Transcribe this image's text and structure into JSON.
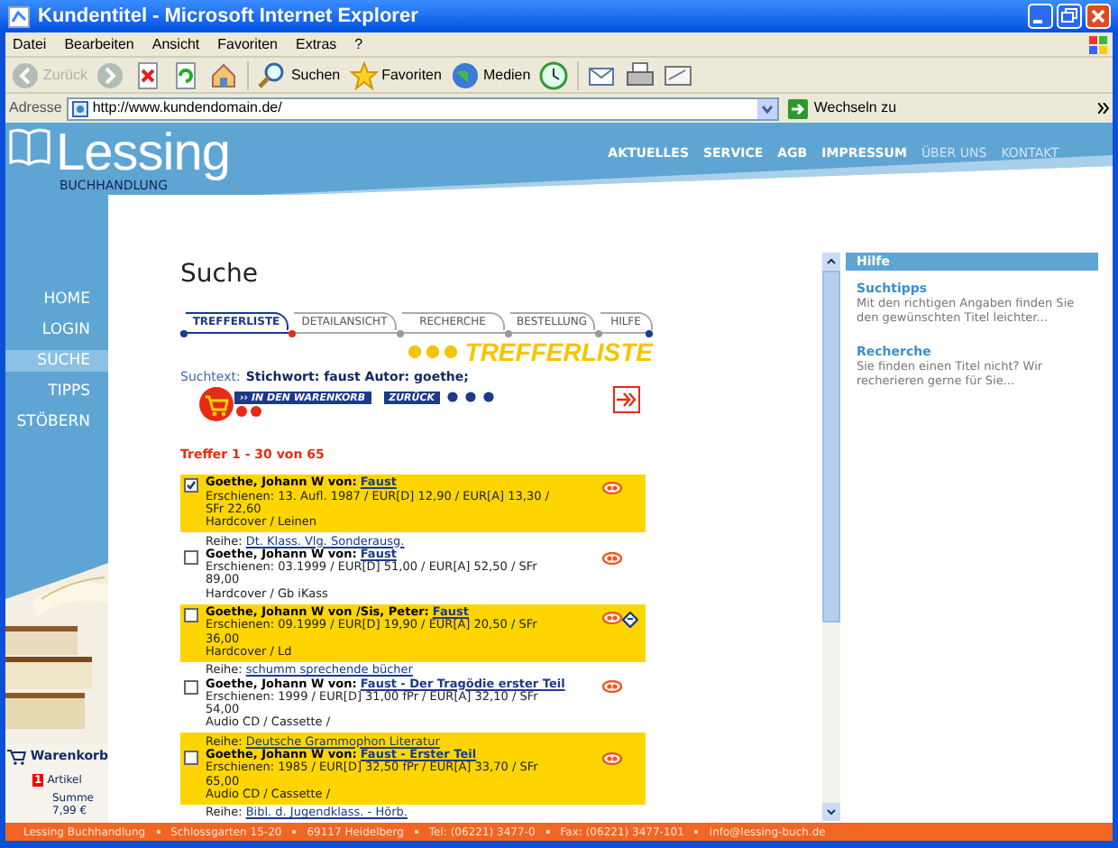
{
  "window": {
    "title": "Kundentitel - Microsoft Internet Explorer"
  },
  "menu": [
    "Datei",
    "Bearbeiten",
    "Ansicht",
    "Favoriten",
    "Extras",
    "?"
  ],
  "toolbar": [
    {
      "kind": "back",
      "label": "Zurück",
      "disabled": true
    },
    {
      "kind": "forward",
      "disabled": true
    },
    {
      "kind": "stop",
      "disabled": false
    },
    {
      "kind": "refresh",
      "disabled": false
    },
    {
      "kind": "home",
      "disabled": false
    },
    {
      "kind": "search",
      "label": "Suchen",
      "disabled": false
    },
    {
      "kind": "favorites",
      "label": "Favoriten",
      "disabled": false
    },
    {
      "kind": "media",
      "label": "Medien",
      "disabled": false
    },
    {
      "kind": "history",
      "disabled": false
    },
    {
      "kind": "mail",
      "disabled": false
    },
    {
      "kind": "print",
      "disabled": false
    },
    {
      "kind": "edit",
      "disabled": false
    }
  ],
  "address": {
    "label": "Adresse",
    "value": "http://www.kundendomain.de/",
    "go": "Wechseln zu"
  },
  "site": {
    "logo": "Lessing",
    "logo_sub": "BUCHHANDLUNG",
    "top_nav": [
      {
        "label": "AKTUELLES",
        "dimmed": false
      },
      {
        "label": "SERVICE",
        "dimmed": false
      },
      {
        "label": "AGB",
        "dimmed": false
      },
      {
        "label": "IMPRESSUM",
        "dimmed": false
      },
      {
        "label": "ÜBER UNS",
        "dimmed": true
      },
      {
        "label": "KONTAKT",
        "dimmed": true
      }
    ],
    "side_nav": [
      {
        "label": "HOME",
        "selected": false
      },
      {
        "label": "LOGIN",
        "selected": false
      },
      {
        "label": "SUCHE",
        "selected": true
      },
      {
        "label": "TIPPS",
        "selected": false
      },
      {
        "label": "STÖBERN",
        "selected": false
      }
    ],
    "cart": {
      "title": "Warenkorb",
      "count": "1",
      "count_label": "Artikel",
      "sum_label": "Summe",
      "sum": "7,99 €"
    }
  },
  "page": {
    "heading": "Suche",
    "steps": [
      {
        "label": "TREFFERLISTE",
        "selected": true
      },
      {
        "label": "DETAILANSICHT",
        "selected": false
      },
      {
        "label": "RECHERCHE",
        "selected": false
      },
      {
        "label": "BESTELLUNG",
        "selected": false
      },
      {
        "label": "HILFE",
        "selected": false
      }
    ],
    "step_title": "TREFFERLISTE",
    "search_label": "Suchtext:",
    "search_text": "Stichwort: faust Autor: goethe;",
    "buttons": [
      "›› IN DEN WARENKORB",
      "ZURÜCK"
    ],
    "hits": "Treffer 1 - 30 von 65",
    "results": [
      {
        "checked": true,
        "author": "Goethe, Johann W von:",
        "title": "Faust",
        "details": "Erschienen: 13. Aufl. 1987 / EUR[D] 12,90 / EUR[A] 13,30 / SFr 22,60",
        "format": "Hardcover / Leinen",
        "icons": [
          {
            "kind": "preview"
          }
        ]
      },
      {
        "reihe_label": "Reihe:",
        "reihe": "Dt. Klass. Vlg. Sonderausg.",
        "checked": false,
        "author": "Goethe, Johann W von:",
        "title": "Faust",
        "details": "Erschienen: 03.1999 / EUR[D] 51,00 / EUR[A] 52,50 / SFr 89,00",
        "format": "Hardcover / Gb iKass",
        "icons": [
          {
            "kind": "preview"
          }
        ]
      },
      {
        "checked": false,
        "author": "Goethe, Johann W von /Sis, Peter:",
        "title": "Faust",
        "details": "Erschienen: 09.1999 / EUR[D] 19,90 / EUR[A] 20,50 / SFr 36,00",
        "format": "Hardcover / Ld",
        "icons": [
          {
            "kind": "preview"
          },
          {
            "kind": "note"
          }
        ]
      },
      {
        "reihe_label": "Reihe:",
        "reihe": "schumm sprechende bücher",
        "checked": false,
        "author": "Goethe, Johann W von:",
        "title": "Faust - Der Tragödie erster Teil",
        "details": "Erschienen: 1999 / EUR[D] 31,00 fPr / EUR[A] 32,10 / SFr 54,00",
        "format": "Audio CD / Cassette /",
        "icons": [
          {
            "kind": "preview"
          }
        ]
      },
      {
        "reihe_label": "Reihe:",
        "reihe": "Deutsche Grammophon Literatur",
        "checked": false,
        "author": "Goethe, Johann W von:",
        "title": "Faust - Erster Teil",
        "details": "Erschienen: 1985 / EUR[D] 32,50 fPr / EUR[A] 33,70 / SFr 65,00",
        "format": "Audio CD / Cassette /",
        "icons": [
          {
            "kind": "preview"
          }
        ]
      },
      {
        "reihe_label": "Reihe:",
        "reihe": "Bibl. d. Jugendklass. - Hörb."
      }
    ]
  },
  "help": {
    "title": "Hilfe",
    "entries": [
      {
        "title": "Suchtipps",
        "text": "Mit den richtigen Angaben finden Sie den gewünschten Titel leichter..."
      },
      {
        "title": "Recherche",
        "text": "Sie finden einen Titel nicht? Wir recherieren gerne für Sie..."
      }
    ]
  },
  "footer": [
    "Lessing Buchhandlung",
    "Schlossgarten 15-20",
    "69117 Heidelberg",
    "Tel: (06221) 3477-0",
    "Fax: (06221) 3477-101",
    "info@lessing-buch.de"
  ]
}
